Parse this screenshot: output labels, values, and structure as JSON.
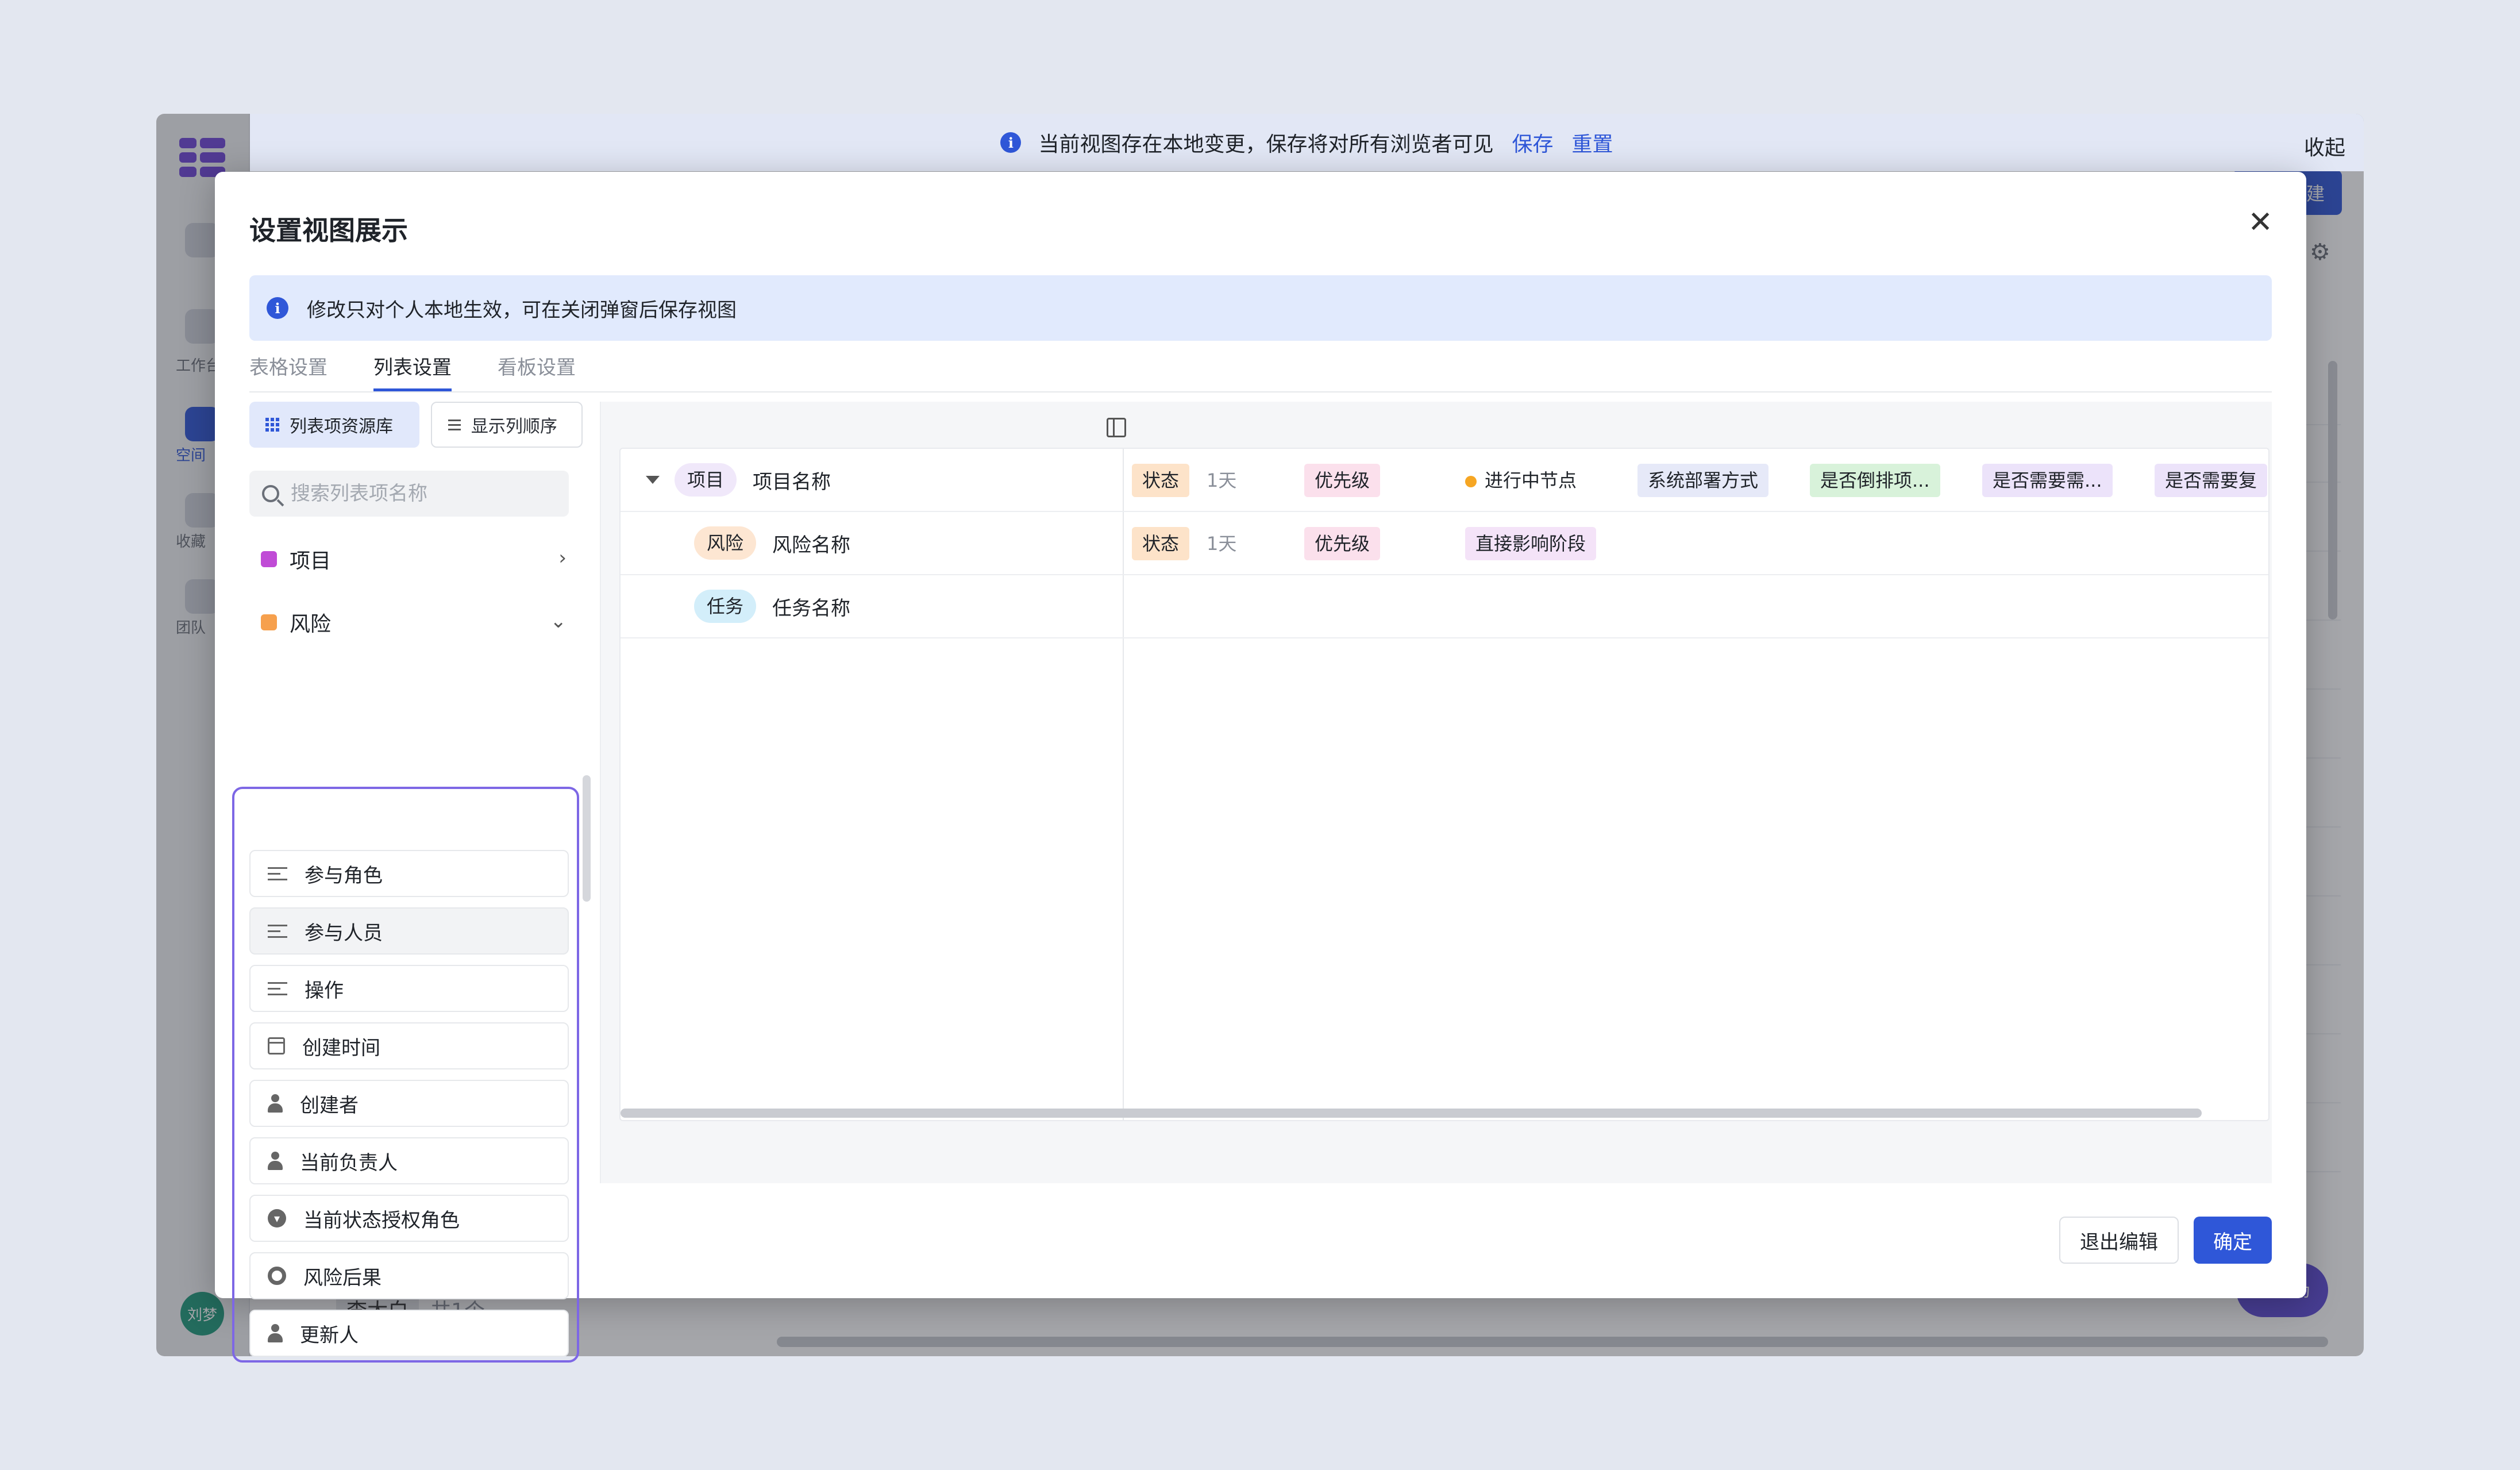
{
  "notification": {
    "message": "当前视图存在本地变更，保存将对所有浏览者可见",
    "save_label": "保存",
    "reset_label": "重置",
    "collapse_label": "收起"
  },
  "background": {
    "sidebar_labels": [
      "工作台",
      "空间",
      "收藏",
      "团队"
    ],
    "avatar_text": "刘梦",
    "group_name": "李太白",
    "group_count": "共1个",
    "new_button_label": "新建",
    "fab_label": "动"
  },
  "dialog": {
    "title": "设置视图展示",
    "info_text": "修改只对个人本地生效，可在关闭弹窗后保存视图",
    "tabs": [
      {
        "label": "表格设置",
        "active": false
      },
      {
        "label": "列表设置",
        "active": true
      },
      {
        "label": "看板设置",
        "active": false
      }
    ],
    "cancel_label": "退出编辑",
    "confirm_label": "确定"
  },
  "left_panel": {
    "library_button": "列表项资源库",
    "order_button": "显示列顺序",
    "search_placeholder": "搜索列表项名称",
    "groups": [
      {
        "label": "项目",
        "color": "#c04bd6",
        "expanded": false
      },
      {
        "label": "风险",
        "color": "#f6a04d",
        "expanded": true
      }
    ],
    "risk_items": [
      {
        "label": "参与角色",
        "icon": "field-settings-icon"
      },
      {
        "label": "参与人员",
        "icon": "field-settings-icon"
      },
      {
        "label": "操作",
        "icon": "field-settings-icon"
      },
      {
        "label": "创建时间",
        "icon": "calendar-icon"
      },
      {
        "label": "创建者",
        "icon": "person-icon"
      },
      {
        "label": "当前负责人",
        "icon": "person-icon"
      },
      {
        "label": "当前状态授权角色",
        "icon": "role-badge-icon"
      },
      {
        "label": "风险后果",
        "icon": "circle-icon"
      },
      {
        "label": "更新人",
        "icon": "person-icon"
      }
    ]
  },
  "preview": {
    "rows": [
      {
        "type_label": "项目",
        "type_color": "#f0e8fa",
        "name": "项目名称",
        "expandable": true,
        "status": "状态",
        "duration": "1天",
        "priority": "优先级",
        "node": "进行中节点",
        "fields": [
          "系统部署方式",
          "是否倒排项...",
          "是否需要需...",
          "是否需要复"
        ]
      },
      {
        "type_label": "风险",
        "type_color": "#fde6d2",
        "name": "风险名称",
        "expandable": false,
        "status": "状态",
        "duration": "1天",
        "priority": "优先级",
        "phase": "直接影响阶段"
      },
      {
        "type_label": "任务",
        "type_color": "#d3eefa",
        "name": "任务名称",
        "expandable": false
      }
    ]
  },
  "colors": {
    "accent": "#2f57d8",
    "highlight_border": "#7d67e5",
    "status_chip": "#fde3c9",
    "priority_chip": "#fbe0ec",
    "field_chip_blue": "#e6e9f8",
    "field_chip_green": "#d8f2da",
    "field_chip_purple": "#ece3fa"
  }
}
